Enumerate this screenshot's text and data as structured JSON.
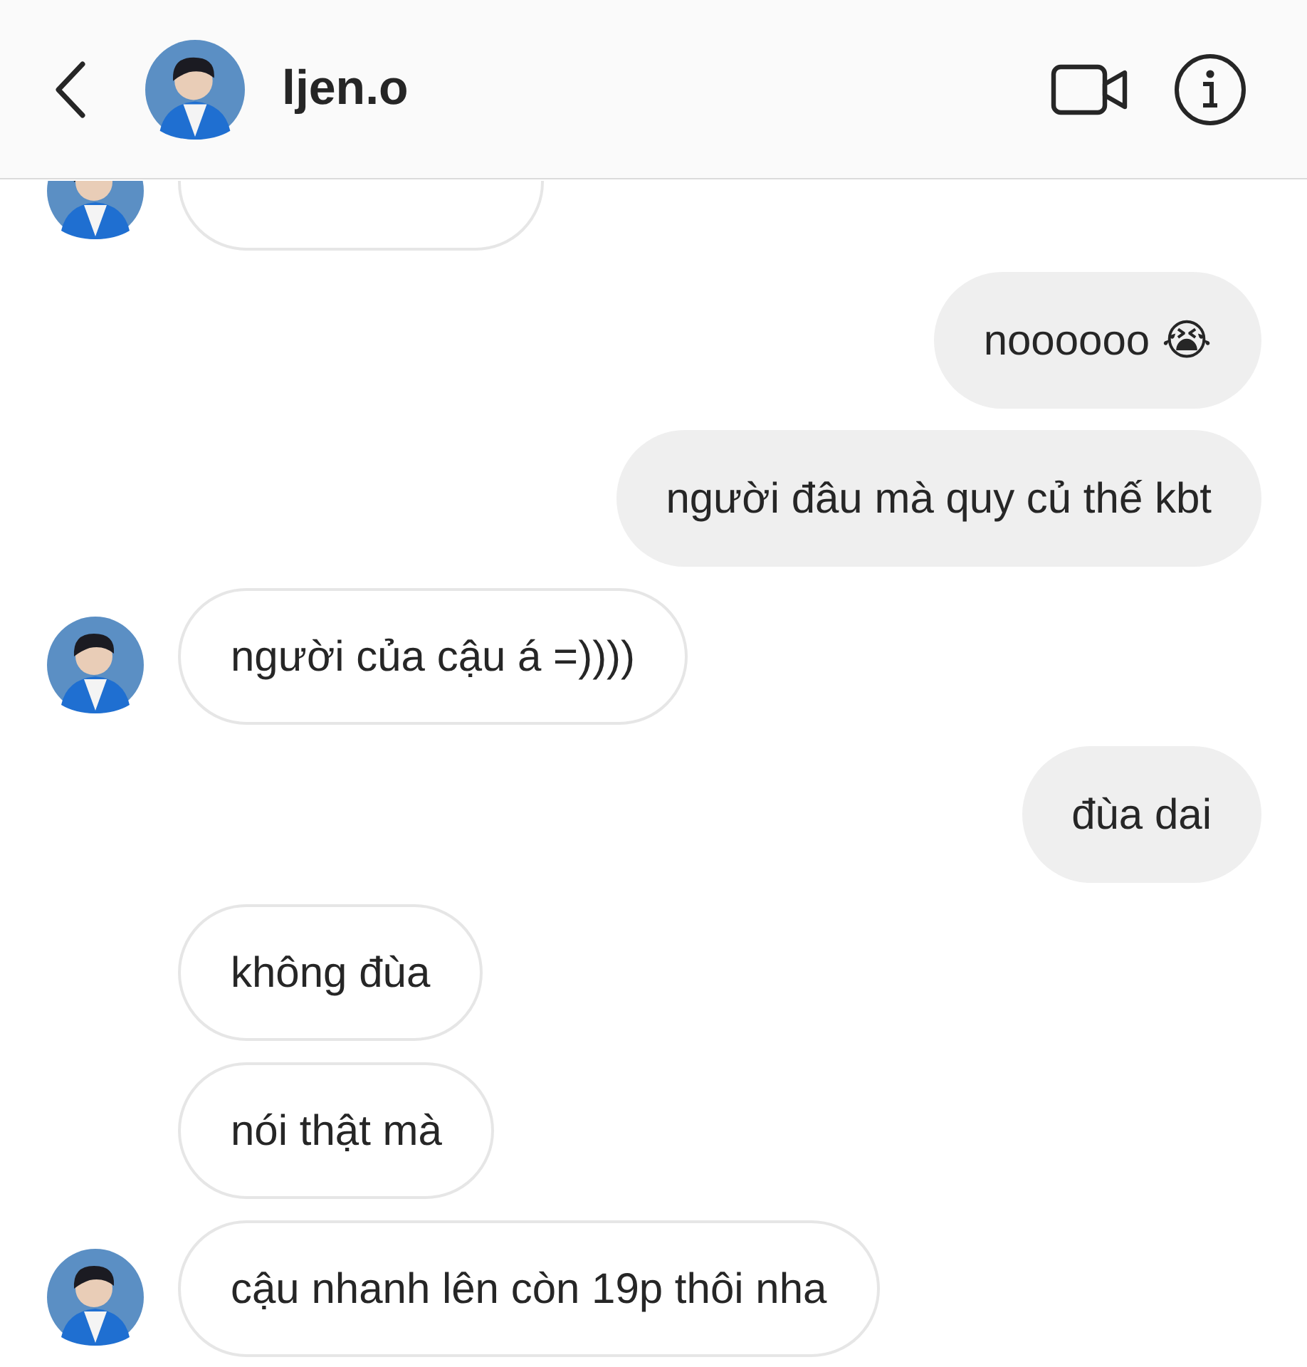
{
  "header": {
    "username": "ljen.o"
  },
  "messages": [
    {
      "kind": "received",
      "show_avatar": true
    },
    {
      "kind": "sent",
      "text": "noooooo 😭",
      "show_avatar": false
    },
    {
      "kind": "sent",
      "text": "người đâu mà quy củ thế kbt",
      "show_avatar": false
    },
    {
      "kind": "received",
      "text": "người của cậu á =))))",
      "show_avatar": true
    },
    {
      "kind": "sent",
      "text": "đùa dai",
      "show_avatar": false
    },
    {
      "kind": "received",
      "text": "không đùa",
      "show_avatar": false
    },
    {
      "kind": "received",
      "text": "nói thật mà",
      "show_avatar": false
    },
    {
      "kind": "received",
      "text": "cậu nhanh lên còn 19p thôi nha",
      "show_avatar": true
    }
  ]
}
